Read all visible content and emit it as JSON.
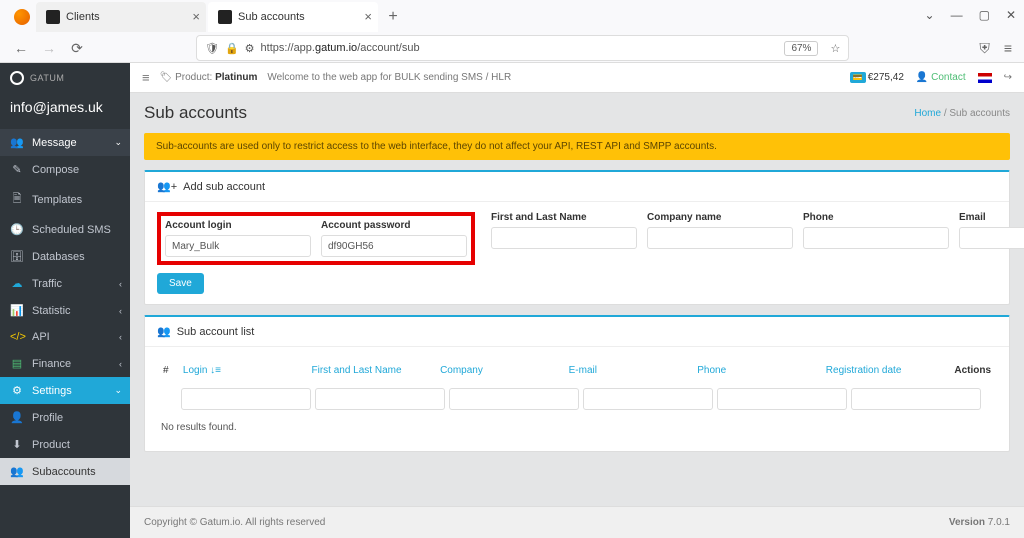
{
  "browser": {
    "tabs": [
      {
        "title": "Clients",
        "active": false
      },
      {
        "title": "Sub accounts",
        "active": true
      }
    ],
    "url_prefix": "https://app.",
    "url_domain": "gatum.io",
    "url_path": "/account/sub",
    "zoom": "67%"
  },
  "sidebar": {
    "brand": "GATUM",
    "user": "info@james.uk",
    "items": [
      {
        "label": "Message",
        "icon": "✉",
        "type": "head",
        "color": "red",
        "chev": "⌄"
      },
      {
        "label": "Compose",
        "icon": "✎",
        "type": "sub"
      },
      {
        "label": "Templates",
        "icon": "🗎",
        "type": "sub"
      },
      {
        "label": "Scheduled SMS",
        "icon": "🕒",
        "type": "sub"
      },
      {
        "label": "Databases",
        "icon": "🗄",
        "type": "sub"
      },
      {
        "label": "Traffic",
        "icon": "☁",
        "type": "head",
        "color": "blue",
        "chev": "‹"
      },
      {
        "label": "Statistic",
        "icon": "📊",
        "type": "head",
        "chev": "‹"
      },
      {
        "label": "API",
        "icon": "</>",
        "type": "head",
        "color": "orange",
        "chev": "‹"
      },
      {
        "label": "Finance",
        "icon": "💲",
        "type": "head",
        "color": "green",
        "chev": "‹"
      },
      {
        "label": "Settings",
        "icon": "⚙",
        "type": "active",
        "color": "pink",
        "chev": "⌄"
      },
      {
        "label": "Profile",
        "icon": "👤",
        "type": "sub"
      },
      {
        "label": "Product",
        "icon": "⬇",
        "type": "sub"
      },
      {
        "label": "Subaccounts",
        "icon": "👥",
        "type": "sub-active"
      }
    ]
  },
  "topbar": {
    "product_label": "Product:",
    "product_value": "Platinum",
    "welcome": "Welcome to the web app for BULK sending SMS / HLR",
    "balance": "€275,42",
    "contact": "Contact"
  },
  "page": {
    "title": "Sub accounts",
    "crumb_home": "Home",
    "crumb_sep": "/",
    "crumb_current": "Sub accounts"
  },
  "alert": "Sub-accounts are used only to restrict access to the web interface, they do not affect your API, REST API and SMPP accounts.",
  "add_panel": {
    "title": "Add sub account",
    "fields": {
      "login_label": "Account login",
      "login_value": "Mary_Bulk",
      "password_label": "Account password",
      "password_value": "df90GH56",
      "name_label": "First and Last Name",
      "company_label": "Company name",
      "phone_label": "Phone",
      "email_label": "Email"
    },
    "save": "Save"
  },
  "list_panel": {
    "title": "Sub account list",
    "cols": {
      "num": "#",
      "login": "Login",
      "name": "First and Last Name",
      "company": "Company",
      "email": "E-mail",
      "phone": "Phone",
      "reg": "Registration date",
      "actions": "Actions"
    },
    "empty": "No results found."
  },
  "footer": {
    "copyright": "Copyright © Gatum.io. All rights reserved",
    "version_label": "Version",
    "version": "7.0.1"
  }
}
